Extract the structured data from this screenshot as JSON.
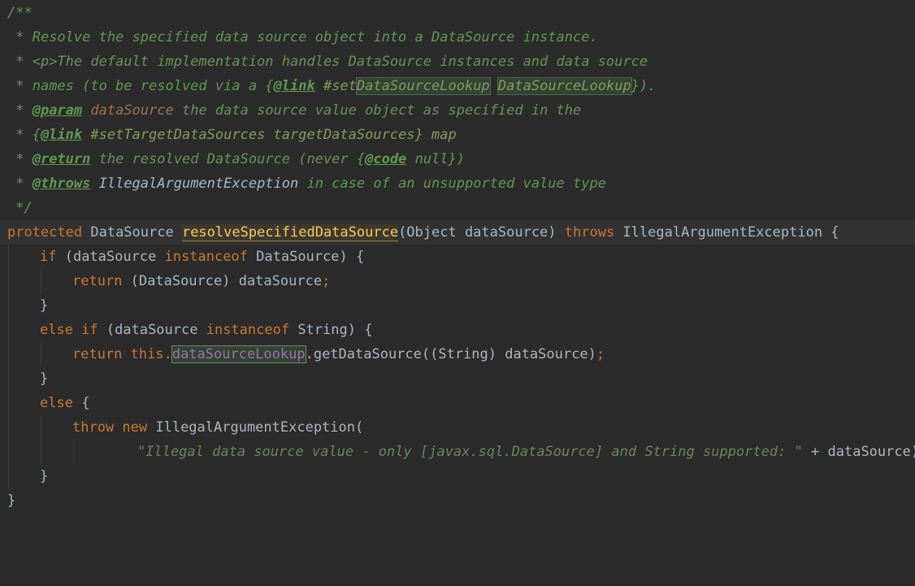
{
  "comment": {
    "open": "/**",
    "l1_star": " * ",
    "l1_text": "Resolve the specified data source object into a DataSource instance.",
    "l2_star": " * ",
    "l2_text": "<p>The default implementation handles DataSource instances and data source",
    "l3_star": " * ",
    "l3_pre": "names (to be resolved via a {",
    "l3_link_tag": "@link",
    "l3_ref": " #set",
    "l3_hl1": "DataSourceLookup",
    "l3_space": " ",
    "l3_hl2": "DataSourceLookup",
    "l3_post": "}).",
    "l4_star": " * ",
    "l4_tag": "@param",
    "l4_param": " dataSource",
    "l4_text": " the data source value object as specified in the",
    "l5_star": " * {",
    "l5_tag": "@link",
    "l5_text": " #setTargetDataSources targetDataSources} map",
    "l6_star": " * ",
    "l6_tag": "@return",
    "l6_pre": " the resolved DataSource (never {",
    "l6_code": "@code",
    "l6_post": " null})",
    "l7_star": " * ",
    "l7_tag": "@throws",
    "l7_exc": " IllegalArgumentException",
    "l7_text": " in case of an unsupported value type",
    "close": " */"
  },
  "code": {
    "sig_protected": "protected",
    "sig_type": " DataSource ",
    "sig_method": "resolveSpecifiedDataSource",
    "sig_params": "(Object dataSource) ",
    "sig_throws": "throws",
    "sig_exc": " IllegalArgumentException {",
    "if_kw": "if",
    "if_open": " (dataSource ",
    "if_instanceof": "instanceof",
    "if_rest": " DataSource) {",
    "ret1_kw": "return",
    "ret1_rest": " (DataSource) dataSource",
    "semi": ";",
    "brace_close": "}",
    "elseif_kw": "else if",
    "elseif_open": " (dataSource ",
    "elseif_instanceof": "instanceof",
    "elseif_rest": " String) {",
    "ret2_kw": "return this.",
    "ret2_field": "dataSourceLookup",
    "ret2_rest": ".getDataSource((String) dataSource)",
    "else_kw": "else",
    "else_rest": " {",
    "throw_kw": "throw new",
    "throw_rest": " IllegalArgumentException(",
    "msg_str": "\"Illegal data source value - only [javax.sql.DataSource] and String supported: \"",
    "msg_rest": " + dataSource)",
    "method_close": "}"
  }
}
